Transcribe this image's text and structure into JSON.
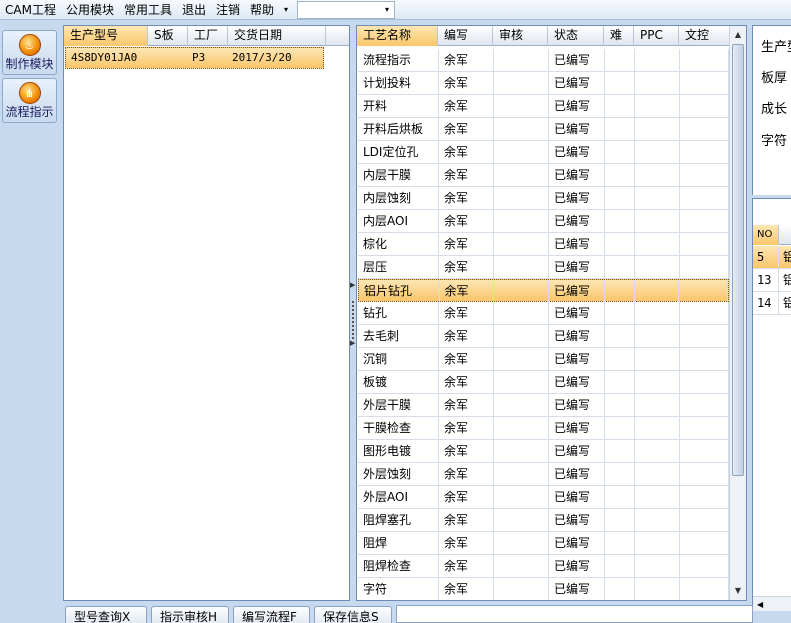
{
  "menu": {
    "items": [
      "CAM工程",
      "公用模块",
      "常用工具",
      "退出",
      "注销",
      "帮助"
    ],
    "arrow": "▾",
    "combo_value": ""
  },
  "toolbar": {
    "buttons": [
      {
        "label": "制作模块",
        "icon": "fire-icon",
        "glyph": "♨"
      },
      {
        "label": "流程指示",
        "icon": "flow-icon",
        "glyph": "⋔"
      }
    ]
  },
  "model_grid": {
    "columns": [
      "生产型号",
      "S板",
      "工厂",
      "交货日期"
    ],
    "rows": [
      {
        "model": "4S8DY01JA0",
        "s_board": "",
        "factory": "P3",
        "delivery_date": "2017/3/20",
        "selected": true
      }
    ]
  },
  "process_grid": {
    "columns": [
      "工艺名称",
      "编写",
      "审核",
      "状态",
      "难",
      "PPC",
      "文控"
    ],
    "rows": [
      {
        "name": "流程指示",
        "writer": "余军",
        "reviewer": "",
        "status": "已编写"
      },
      {
        "name": "计划投料",
        "writer": "余军",
        "reviewer": "",
        "status": "已编写"
      },
      {
        "name": "开料",
        "writer": "余军",
        "reviewer": "",
        "status": "已编写"
      },
      {
        "name": "开料后烘板",
        "writer": "余军",
        "reviewer": "",
        "status": "已编写"
      },
      {
        "name": "LDI定位孔",
        "writer": "余军",
        "reviewer": "",
        "status": "已编写"
      },
      {
        "name": "内层干膜",
        "writer": "余军",
        "reviewer": "",
        "status": "已编写"
      },
      {
        "name": "内层蚀刻",
        "writer": "余军",
        "reviewer": "",
        "status": "已编写"
      },
      {
        "name": "内层AOI",
        "writer": "余军",
        "reviewer": "",
        "status": "已编写"
      },
      {
        "name": "棕化",
        "writer": "余军",
        "reviewer": "",
        "status": "已编写"
      },
      {
        "name": "层压",
        "writer": "余军",
        "reviewer": "",
        "status": "已编写"
      },
      {
        "name": "铝片钻孔",
        "writer": "余军",
        "reviewer": "",
        "status": "已编写",
        "selected": true
      },
      {
        "name": "钻孔",
        "writer": "余军",
        "reviewer": "",
        "status": "已编写"
      },
      {
        "name": "去毛刺",
        "writer": "余军",
        "reviewer": "",
        "status": "已编写"
      },
      {
        "name": "沉铜",
        "writer": "余军",
        "reviewer": "",
        "status": "已编写"
      },
      {
        "name": "板镀",
        "writer": "余军",
        "reviewer": "",
        "status": "已编写"
      },
      {
        "name": "外层干膜",
        "writer": "余军",
        "reviewer": "",
        "status": "已编写"
      },
      {
        "name": "干膜检查",
        "writer": "余军",
        "reviewer": "",
        "status": "已编写"
      },
      {
        "name": "图形电镀",
        "writer": "余军",
        "reviewer": "",
        "status": "已编写"
      },
      {
        "name": "外层蚀刻",
        "writer": "余军",
        "reviewer": "",
        "status": "已编写"
      },
      {
        "name": "外层AOI",
        "writer": "余军",
        "reviewer": "",
        "status": "已编写"
      },
      {
        "name": "阻焊塞孔",
        "writer": "余军",
        "reviewer": "",
        "status": "已编写"
      },
      {
        "name": "阻焊",
        "writer": "余军",
        "reviewer": "",
        "status": "已编写"
      },
      {
        "name": "阻焊检查",
        "writer": "余军",
        "reviewer": "",
        "status": "已编写"
      },
      {
        "name": "字符",
        "writer": "余军",
        "reviewer": "",
        "status": "已编写"
      }
    ]
  },
  "right_panel": {
    "labels": [
      "生产型",
      "板厚",
      "成长",
      "字符"
    ],
    "sub_columns": [
      "NO",
      ""
    ],
    "sub_rows": [
      {
        "no": "5",
        "val": "铝",
        "selected": true
      },
      {
        "no": "13",
        "val": "铝"
      },
      {
        "no": "14",
        "val": "铝"
      }
    ],
    "scroll_arrow": "◀"
  },
  "bottom_buttons": [
    "型号查询X",
    "指示审核H",
    "编写流程F",
    "保存信息S"
  ],
  "colors": {
    "background": "#c7d9ef",
    "selection": "#f9c66a",
    "border": "#6f8db3"
  }
}
